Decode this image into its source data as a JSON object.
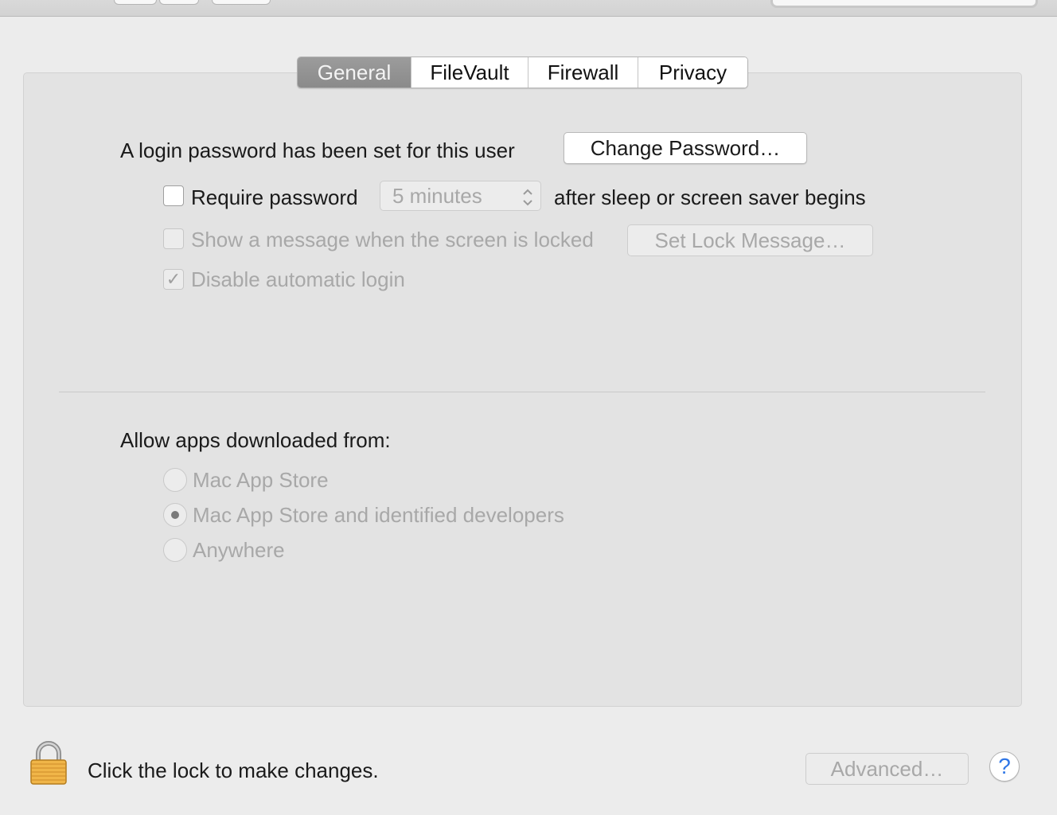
{
  "tabs": [
    {
      "label": "General",
      "selected": true
    },
    {
      "label": "FileVault",
      "selected": false
    },
    {
      "label": "Firewall",
      "selected": false
    },
    {
      "label": "Privacy",
      "selected": false
    }
  ],
  "general": {
    "login_password_text": "A login password has been set for this user",
    "change_password_label": "Change Password…",
    "require_password": {
      "label": "Require password",
      "checked": false,
      "delay_value": "5 minutes",
      "suffix": "after sleep or screen saver begins"
    },
    "show_message": {
      "label": "Show a message when the screen is locked",
      "checked": false,
      "enabled": false,
      "button_label": "Set Lock Message…"
    },
    "disable_auto_login": {
      "label": "Disable automatic login",
      "checked": true,
      "enabled": false,
      "checkmark": "✓"
    }
  },
  "apps": {
    "heading": "Allow apps downloaded from:",
    "options": [
      {
        "label": "Mac App Store",
        "selected": false
      },
      {
        "label": "Mac App Store and identified developers",
        "selected": true
      },
      {
        "label": "Anywhere",
        "selected": false
      }
    ]
  },
  "footer": {
    "lock_text": "Click the lock to make changes.",
    "advanced_label": "Advanced…",
    "help_label": "?"
  },
  "icons": {
    "lock": "lock-icon",
    "help": "question-mark-icon",
    "popup_arrows": "chevron-up-down-icon"
  },
  "colors": {
    "pane_background": "#e3e3e3",
    "window_background": "#ececec",
    "selected_tab": "#8f8f8f",
    "disabled_text": "#a8a8a8",
    "help_accent": "#2f76e6",
    "lock_gold": "#f0b548"
  }
}
